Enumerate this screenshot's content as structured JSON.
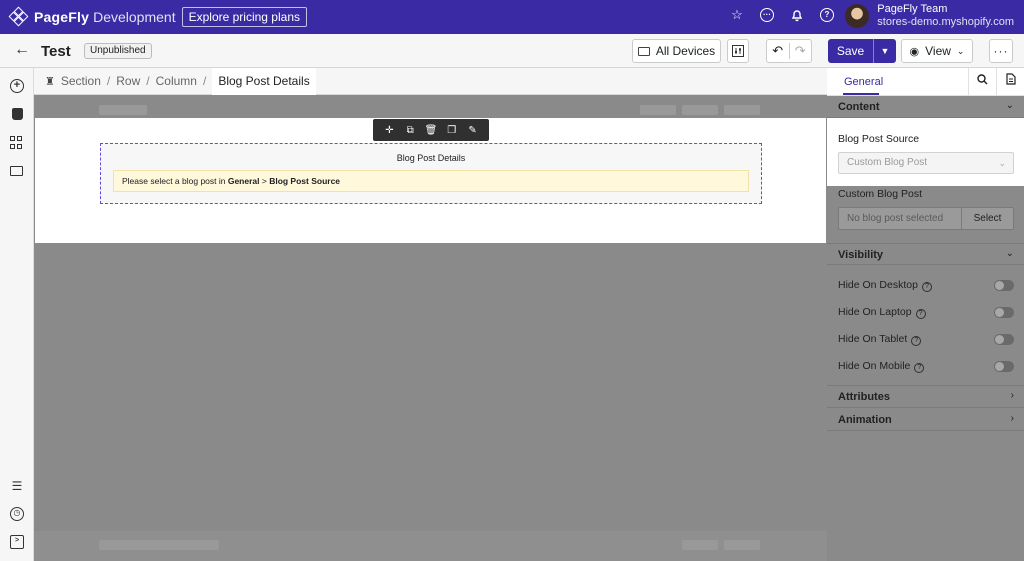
{
  "header": {
    "brand": "PageFly",
    "env": "Development",
    "pricing_label": "Explore pricing plans",
    "user_name": "PageFly Team",
    "user_store": "stores-demo.myshopify.com",
    "icons": [
      "star-icon",
      "chat-icon",
      "bell-icon",
      "help-icon"
    ]
  },
  "toolbar": {
    "page_title": "Test",
    "status": "Unpublished",
    "devices_label": "All Devices",
    "save_label": "Save",
    "view_label": "View",
    "more_label": "···"
  },
  "breadcrumb": {
    "items": [
      "Section",
      "Row",
      "Column"
    ],
    "current": "Blog Post Details"
  },
  "canvas": {
    "element_title": "Blog Post Details",
    "notice_prefix": "Please select a blog post in ",
    "notice_general": "General",
    "notice_sep": " > ",
    "notice_source": "Blog Post Source"
  },
  "panel": {
    "tab_general": "General",
    "content_title": "Content",
    "blog_source_label": "Blog Post Source",
    "blog_source_value": "Custom Blog Post",
    "custom_post_label": "Custom Blog Post",
    "custom_post_placeholder": "No blog post selected",
    "select_label": "Select",
    "visibility_title": "Visibility",
    "toggles": [
      {
        "label": "Hide On Desktop",
        "on": false
      },
      {
        "label": "Hide On Laptop",
        "on": false
      },
      {
        "label": "Hide On Tablet",
        "on": false
      },
      {
        "label": "Hide On Mobile",
        "on": false
      }
    ],
    "attributes_title": "Attributes",
    "animation_title": "Animation"
  },
  "colors": {
    "brand": "#3a2aa3",
    "selection": "#5b4ee0",
    "notice_bg": "#fff8db"
  }
}
